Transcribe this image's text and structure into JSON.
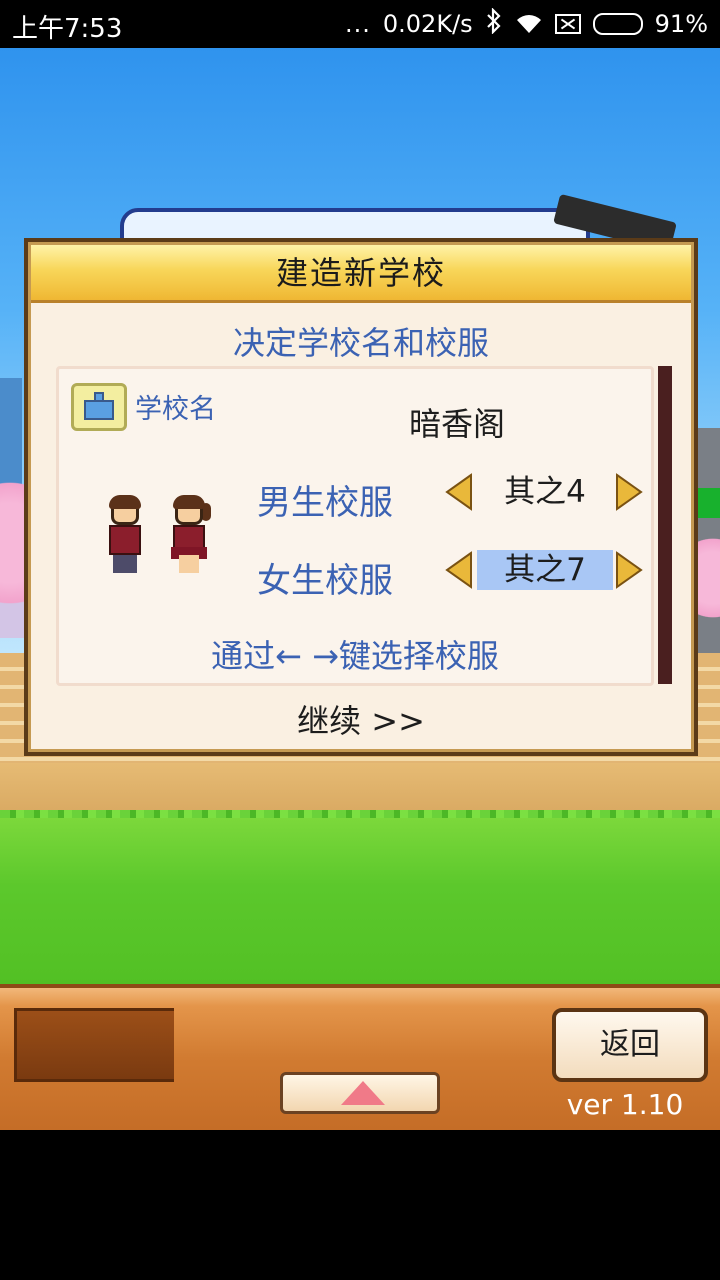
{
  "status_bar": {
    "time": "上午7:53",
    "signal_dots": "...",
    "speed": "0.02K/s",
    "battery": "91%",
    "icons": [
      "bluetooth-icon",
      "wifi-icon",
      "no-sim-icon",
      "battery-icon"
    ]
  },
  "dialog": {
    "title": "建造新学校",
    "subtitle": "决定学校名和校服",
    "school_name_label": "学校名",
    "school_name_value": "暗香阁",
    "boy_uniform_label": "男生校服",
    "boy_uniform_value": "其之4",
    "girl_uniform_label": "女生校服",
    "girl_uniform_value": "其之7",
    "hint": "通过← →键选择校服",
    "continue": "继续 >>"
  },
  "bottom_bar": {
    "back_label": "返回",
    "version": "ver 1.10"
  },
  "colors": {
    "title_gold": "#f8d659",
    "label_blue": "#3b62b3",
    "selected_highlight": "#a9c7f5",
    "arrow_gold": "#e9b83a"
  }
}
